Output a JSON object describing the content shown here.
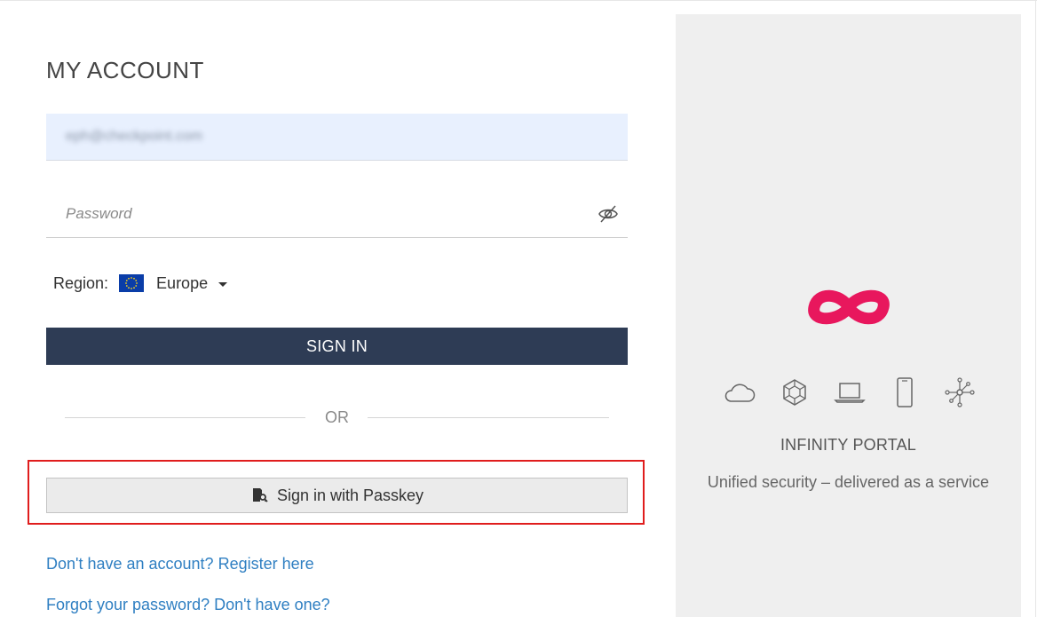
{
  "header": {
    "title": "MY ACCOUNT"
  },
  "form": {
    "email_value": "eph@checkpoint.com",
    "password_placeholder": "Password",
    "region_label": "Region:",
    "region_value": "Europe",
    "sign_in_label": "SIGN IN",
    "or_label": "OR",
    "passkey_label": "Sign in with Passkey"
  },
  "links": {
    "register": "Don't have an account? Register here",
    "forgot": "Forgot your password? Don't have one?"
  },
  "panel": {
    "title": "INFINITY PORTAL",
    "tagline": "Unified security – delivered as a service",
    "feature_icons": [
      "cloud-icon",
      "network-cube-icon",
      "laptop-icon",
      "mobile-icon",
      "iot-hub-icon"
    ]
  },
  "colors": {
    "primary_button": "#2e3c55",
    "brand_logo": "#e8175d",
    "link": "#2f7fc2",
    "highlight": "#e01d1d"
  }
}
